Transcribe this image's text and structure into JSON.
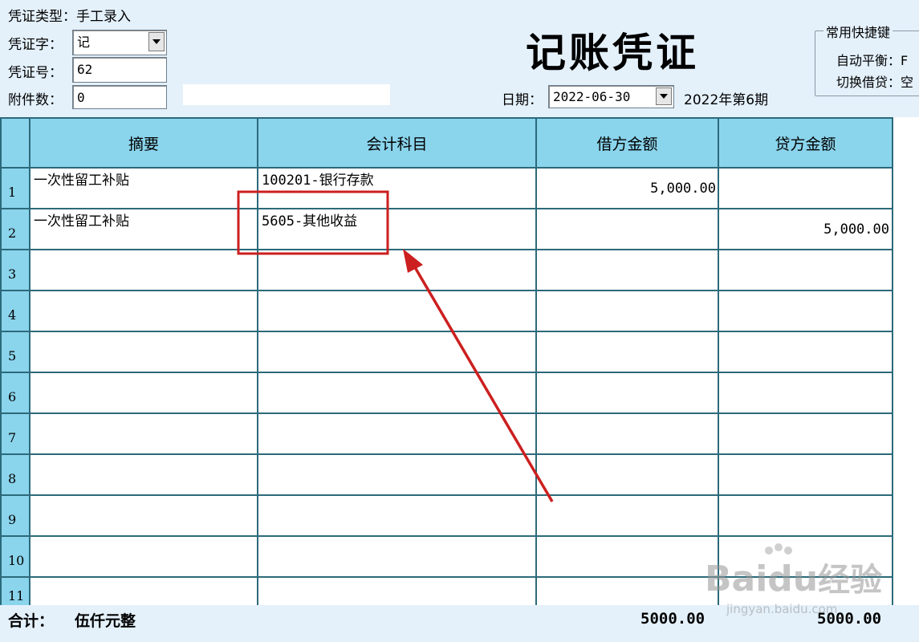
{
  "header": {
    "voucher_type_label": "凭证类型：",
    "voucher_type_value": "手工录入",
    "voucher_word_label": "凭证字：",
    "voucher_word_value": "记",
    "voucher_no_label": "凭证号：",
    "voucher_no_value": "62",
    "attach_label": "附件数：",
    "attach_value": "0",
    "title": "记账凭证",
    "date_label": "日期：",
    "date_value": "2022-06-30",
    "period": "2022年第6期"
  },
  "shortcuts": {
    "title": "常用快捷键",
    "items": [
      "自动平衡：F",
      "切换借贷：空"
    ]
  },
  "table": {
    "columns": [
      "摘要",
      "会计科目",
      "借方金额",
      "贷方金额"
    ],
    "row_numbers": [
      "1",
      "2",
      "3",
      "4",
      "5",
      "6",
      "7",
      "8",
      "9",
      "10",
      "11"
    ],
    "rows": [
      {
        "summary": "一次性留工补贴",
        "account": "100201-银行存款",
        "debit": "5,000.00",
        "credit": ""
      },
      {
        "summary": "一次性留工补贴",
        "account": "5605-其他收益",
        "debit": "",
        "credit": "5,000.00"
      }
    ]
  },
  "footer": {
    "total_label": "合计：",
    "total_words": "伍仟元整",
    "debit_total": "5000.00",
    "credit_total": "5000.00"
  },
  "watermark": {
    "brand": "Baidu",
    "brand_cn": "经验",
    "url": "jingyan.baidu.com"
  },
  "colors": {
    "background": "#e4f1fb",
    "header_fill": "#8ad4ec",
    "grid_line": "#2c6a7a",
    "annotation": "#cc1f1f"
  }
}
